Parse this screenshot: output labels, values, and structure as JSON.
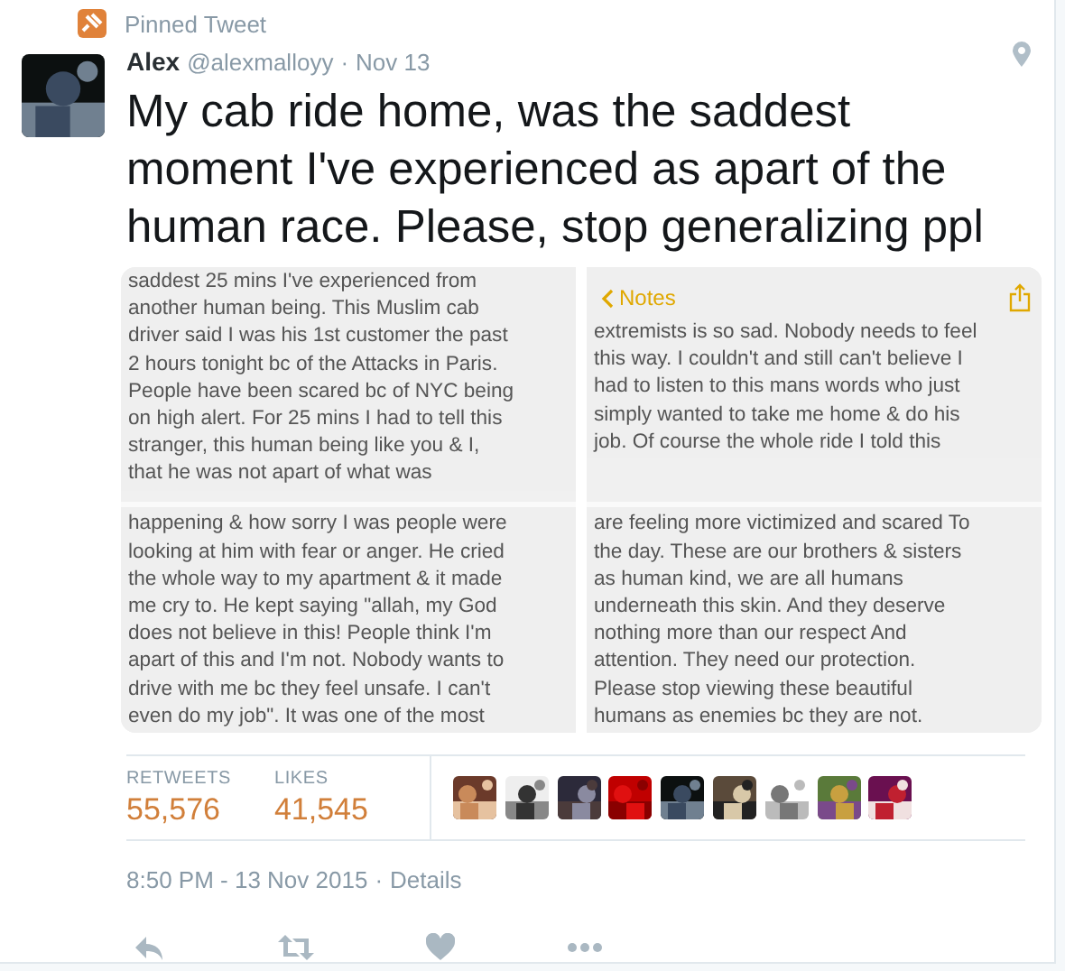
{
  "pinned_label": "Pinned Tweet",
  "author": {
    "name": "Alex",
    "handle": "@alexmalloyy",
    "separator": "·",
    "date": "Nov 13"
  },
  "tweet_text": "My cab ride home, was the saddest moment I've experienced as apart of the human race. Please, stop generalizing ppl",
  "media": [
    {
      "sections": [
        {
          "lines": [
            "saddest 25 mins I've experienced from",
            "another human being. This Muslim cab",
            "driver said I was his 1st customer the past",
            "2 hours tonight bc of the Attacks in Paris.",
            "People have been scared bc of NYC being",
            "on high alert. For 25 mins I had to tell this",
            "stranger, this human being like you & I,",
            "that he was not apart of what was"
          ]
        },
        {
          "lines": [
            "happening & how sorry I was people were",
            "looking at him with fear or anger. He cried",
            "the whole way to my apartment & it made",
            "me cry to. He kept saying \"allah, my God",
            "does not believe in this! People think I'm",
            "apart of this and I'm not. Nobody wants to",
            "drive with me bc they feel unsafe. I can't",
            "even do my job\". It was one of the most"
          ]
        }
      ]
    },
    {
      "header": {
        "back_label": "Notes"
      },
      "sections": [
        {
          "lines": [
            "extremists is so sad. Nobody needs to feel",
            "this way. I couldn't and still can't believe I",
            "had to listen to this mans words who just",
            "simply wanted to take me home & do his",
            "job. Of course the whole ride I told this"
          ]
        },
        {
          "lines": [
            "are feeling more victimized and scared To",
            "the day. These are our brothers & sisters",
            "as human kind, we are all humans",
            "underneath this skin. And they deserve",
            "nothing more than our respect And",
            "attention. They need our protection.",
            "Please stop viewing these beautiful",
            "humans as enemies bc they are not."
          ]
        }
      ]
    }
  ],
  "stats": [
    {
      "label": "RETWEETS",
      "value": "55,576"
    },
    {
      "label": "LIKES",
      "value": "41,545"
    }
  ],
  "timestamp": "8:50 PM - 13 Nov 2015",
  "timestamp_separator": "·",
  "details_link": "Details"
}
